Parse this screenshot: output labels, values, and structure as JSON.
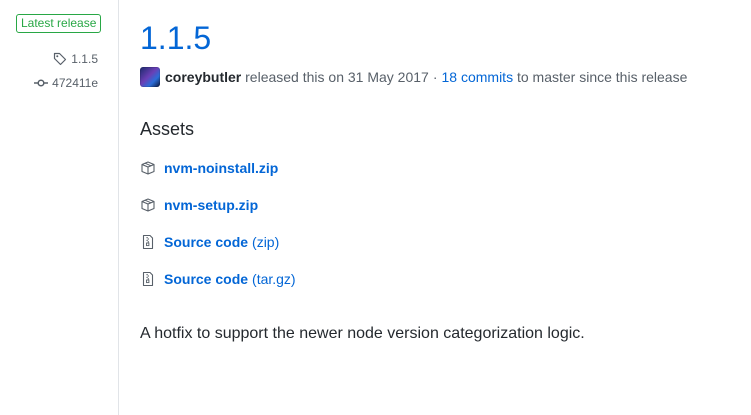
{
  "sidebar": {
    "badge": "Latest release",
    "tag": "1.1.5",
    "commit": "472411e"
  },
  "release": {
    "title": "1.1.5",
    "author": "coreybutler",
    "released_text": "released this on 31 May 2017",
    "separator": "·",
    "commits_link": "18 commits",
    "commits_suffix": "to master since this release"
  },
  "assets": {
    "heading": "Assets",
    "items": [
      {
        "name": "nvm-noinstall.zip",
        "ext": "",
        "icon": "package-icon"
      },
      {
        "name": "nvm-setup.zip",
        "ext": "",
        "icon": "package-icon"
      },
      {
        "name": "Source code",
        "ext": "(zip)",
        "icon": "file-zip-icon"
      },
      {
        "name": "Source code",
        "ext": "(tar.gz)",
        "icon": "file-zip-icon"
      }
    ]
  },
  "notes": "A hotfix to support the newer node version categorization logic.",
  "colors": {
    "link": "#0366d6",
    "badge": "#28a745",
    "muted": "#586069",
    "text": "#24292e"
  }
}
